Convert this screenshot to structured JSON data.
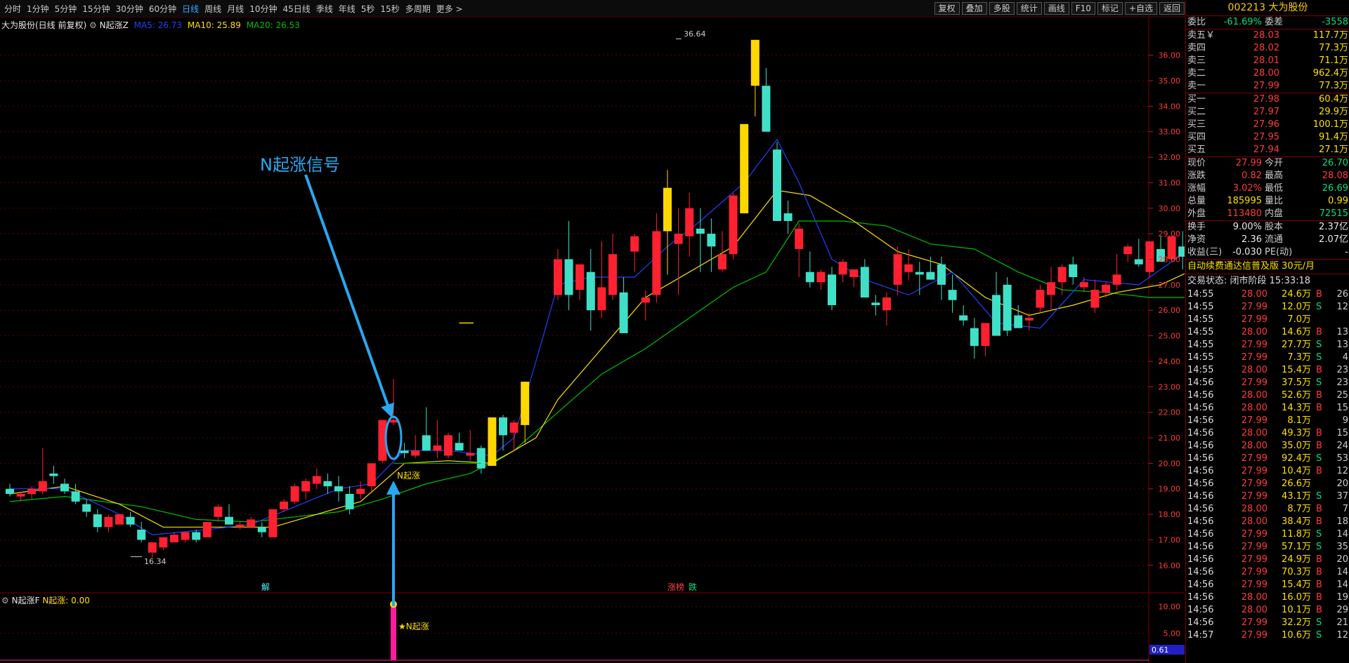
{
  "toolbar": {
    "periods": [
      "分时",
      "1分钟",
      "5分钟",
      "15分钟",
      "30分钟",
      "60分钟",
      "日线",
      "周线",
      "月线",
      "10分钟",
      "45日线",
      "季线",
      "年线",
      "5秒",
      "15秒",
      "多周期",
      "更多 >"
    ],
    "active_period": "日线",
    "tools": [
      "复权",
      "叠加",
      "多股",
      "统计",
      "画线",
      "F10",
      "标记",
      "+自选",
      "返回"
    ]
  },
  "legend": {
    "stock": "大为股份(日线 前复权)",
    "indicator": "N起涨Z",
    "ma5": "MA5: 26.73",
    "ma10": "MA10: 25.89",
    "ma20": "MA20: 26.53"
  },
  "indicator_legend": {
    "name": "N起涨F",
    "value": "N起涨: 0.00"
  },
  "annotations": {
    "signal_title": "N起涨信号",
    "signal_label": "N起涨",
    "low_label": "16.34",
    "high_label": "36.64",
    "star_label": "★N起涨",
    "marker_jie": "解",
    "marker_zhang": "涨榜",
    "marker_die": "跌",
    "ind_box": "0.61"
  },
  "colors": {
    "up": "#ff2030",
    "down": "#40e0c8",
    "limit_up": "#ffd700",
    "ma5": "#2040ff",
    "ma10": "#ffe000",
    "ma20": "#00c000",
    "signal_arrow": "#29a8f0",
    "magenta": "#ff1aa0"
  },
  "chart_data": {
    "type": "candlestick",
    "ylim": [
      15.5,
      37.2
    ],
    "yticks": [
      16,
      17,
      18,
      19,
      20,
      21,
      22,
      23,
      24,
      25,
      26,
      27,
      28,
      29,
      30,
      31,
      32,
      33,
      34,
      35,
      36
    ],
    "candles": [
      [
        19.0,
        19.2,
        18.7,
        18.8
      ],
      [
        18.7,
        18.9,
        18.5,
        18.8
      ],
      [
        18.8,
        19.1,
        18.6,
        19.0
      ],
      [
        18.9,
        20.6,
        18.8,
        19.3
      ],
      [
        19.6,
        19.9,
        19.2,
        19.5
      ],
      [
        19.2,
        19.4,
        18.8,
        18.9
      ],
      [
        18.9,
        19.2,
        18.4,
        18.5
      ],
      [
        18.4,
        18.6,
        17.9,
        18.1
      ],
      [
        18.0,
        18.2,
        17.3,
        17.5
      ],
      [
        17.5,
        18.0,
        17.3,
        17.9
      ],
      [
        17.6,
        18.0,
        17.6,
        18.0
      ],
      [
        17.9,
        18.1,
        17.5,
        17.6
      ],
      [
        17.4,
        17.7,
        16.9,
        17.0
      ],
      [
        16.5,
        16.9,
        16.3,
        16.9
      ],
      [
        16.7,
        17.1,
        16.6,
        17.1
      ],
      [
        16.9,
        17.3,
        16.9,
        17.2
      ],
      [
        17.0,
        17.3,
        16.9,
        17.3
      ],
      [
        17.3,
        17.4,
        16.9,
        17.0
      ],
      [
        17.1,
        17.7,
        17.1,
        17.7
      ],
      [
        17.9,
        18.4,
        17.7,
        18.3
      ],
      [
        17.9,
        18.4,
        17.8,
        17.6
      ],
      [
        17.5,
        17.7,
        17.4,
        17.6
      ],
      [
        17.5,
        17.9,
        17.5,
        17.8
      ],
      [
        17.5,
        17.7,
        17.1,
        17.3
      ],
      [
        17.1,
        18.2,
        17.1,
        18.2
      ],
      [
        18.2,
        18.6,
        18.1,
        18.5
      ],
      [
        18.5,
        19.2,
        18.4,
        19.1
      ],
      [
        18.9,
        19.4,
        18.6,
        19.3
      ],
      [
        19.2,
        19.8,
        19.0,
        19.5
      ],
      [
        19.3,
        19.6,
        18.8,
        19.1
      ],
      [
        19.1,
        19.5,
        18.5,
        18.9
      ],
      [
        18.8,
        19.1,
        18.0,
        18.2
      ],
      [
        18.8,
        19.3,
        18.6,
        19.0
      ],
      [
        19.1,
        20.0,
        18.9,
        20.0
      ],
      [
        20.1,
        21.7,
        20.0,
        21.7
      ],
      [
        21.6,
        23.3,
        21.5,
        21.7
      ],
      [
        20.5,
        20.8,
        20.2,
        20.4
      ],
      [
        20.3,
        21.1,
        20.2,
        20.5
      ],
      [
        21.1,
        22.2,
        20.5,
        20.5
      ],
      [
        20.5,
        21.7,
        20.2,
        20.7
      ],
      [
        20.3,
        21.2,
        20.2,
        21.1
      ],
      [
        20.8,
        21.2,
        20.6,
        20.5
      ],
      [
        20.3,
        21.3,
        20.1,
        20.4
      ],
      [
        20.6,
        20.7,
        19.6,
        19.8
      ],
      [
        19.9,
        21.8,
        19.9,
        21.8
      ],
      [
        21.8,
        21.9,
        20.5,
        21.1
      ],
      [
        21.2,
        21.7,
        20.5,
        21.6
      ],
      [
        21.5,
        22.0,
        20.8,
        23.2
      ],
      [
        null,
        null,
        null,
        null
      ],
      [
        null,
        null,
        null,
        null
      ],
      [
        26.6,
        28.4,
        26.4,
        28.0
      ],
      [
        28.0,
        29.5,
        26.0,
        26.6
      ],
      [
        26.8,
        27.8,
        26.4,
        27.8
      ],
      [
        27.5,
        28.4,
        25.2,
        26.0
      ],
      [
        26.0,
        28.7,
        25.7,
        26.9
      ],
      [
        26.6,
        29.0,
        26.4,
        28.2
      ],
      [
        26.7,
        27.3,
        25.4,
        25.1
      ],
      [
        28.3,
        29.0,
        27.5,
        28.9
      ],
      [
        26.3,
        26.8,
        25.6,
        26.5
      ],
      [
        26.6,
        29.8,
        26.3,
        29.1
      ],
      [
        29.1,
        31.5,
        27.4,
        30.8
      ],
      [
        28.6,
        30.0,
        26.6,
        29.0
      ],
      [
        28.9,
        30.6,
        28.1,
        30.0
      ],
      [
        29.2,
        30.0,
        27.5,
        29.0
      ],
      [
        29.0,
        29.6,
        27.5,
        28.5
      ],
      [
        27.6,
        29.1,
        27.5,
        28.2
      ],
      [
        28.2,
        30.6,
        28.0,
        30.5
      ],
      [
        29.8,
        33.3,
        29.8,
        33.3
      ],
      [
        34.8,
        36.6,
        33.6,
        36.6
      ],
      [
        34.8,
        35.5,
        33.0,
        33.0
      ],
      [
        32.3,
        32.6,
        30.0,
        29.5
      ],
      [
        29.8,
        30.3,
        29.0,
        29.5
      ],
      [
        28.4,
        29.4,
        27.3,
        29.2
      ],
      [
        27.5,
        28.3,
        26.9,
        27.1
      ],
      [
        27.1,
        27.6,
        26.8,
        27.5
      ],
      [
        27.4,
        27.7,
        26.0,
        26.2
      ],
      [
        27.4,
        28.0,
        27.1,
        27.9
      ],
      [
        27.3,
        27.5,
        26.9,
        27.6
      ],
      [
        27.7,
        28.0,
        26.6,
        26.5
      ],
      [
        26.3,
        26.6,
        25.8,
        26.2
      ],
      [
        26.0,
        26.7,
        25.4,
        26.5
      ],
      [
        27.0,
        28.5,
        26.6,
        28.2
      ],
      [
        27.5,
        28.4,
        27.2,
        27.8
      ],
      [
        27.5,
        27.9,
        26.6,
        27.4
      ],
      [
        27.5,
        28.1,
        27.2,
        27.2
      ],
      [
        27.8,
        28.1,
        26.4,
        27.0
      ],
      [
        26.8,
        27.4,
        25.9,
        26.4
      ],
      [
        25.8,
        26.2,
        25.4,
        25.6
      ],
      [
        25.3,
        25.7,
        24.1,
        24.6
      ],
      [
        24.6,
        25.1,
        24.2,
        25.5
      ],
      [
        26.6,
        27.5,
        25.8,
        25.0
      ],
      [
        27.0,
        27.3,
        25.0,
        25.2
      ],
      [
        25.8,
        26.2,
        25.4,
        25.3
      ],
      [
        25.6,
        25.9,
        25.2,
        25.7
      ],
      [
        26.1,
        27.0,
        25.9,
        26.8
      ],
      [
        26.6,
        27.7,
        26.0,
        27.1
      ],
      [
        27.1,
        27.8,
        26.6,
        27.7
      ],
      [
        27.8,
        28.1,
        27.0,
        27.3
      ],
      [
        26.9,
        27.3,
        26.7,
        27.1
      ],
      [
        26.1,
        27.2,
        25.9,
        26.8
      ],
      [
        26.7,
        27.1,
        26.5,
        27.0
      ],
      [
        27.0,
        28.2,
        26.8,
        27.4
      ],
      [
        28.2,
        28.6,
        27.9,
        28.5
      ],
      [
        28.0,
        28.8,
        27.7,
        27.8
      ],
      [
        27.5,
        28.2,
        27.3,
        28.7
      ],
      [
        28.4,
        28.9,
        27.9,
        27.9
      ],
      [
        28.0,
        28.8,
        27.9,
        28.9
      ],
      [
        28.5,
        29.1,
        27.6,
        28.1
      ],
      [
        29.0,
        29.8,
        28.0,
        27.5
      ],
      [
        29.5,
        30.4,
        29.2,
        30.2
      ],
      [
        30.7,
        31.6,
        30.4,
        30.9
      ],
      [
        30.8,
        31.6,
        30.4,
        31.2
      ],
      [
        31.5,
        32.1,
        30.6,
        31.1
      ],
      [
        30.0,
        31.4,
        29.9,
        30.0
      ]
    ],
    "ma5": [
      [
        0,
        19.0
      ],
      [
        5,
        19.0
      ],
      [
        10,
        18.0
      ],
      [
        13,
        17.2
      ],
      [
        18,
        17.4
      ],
      [
        22,
        17.6
      ],
      [
        26,
        18.3
      ],
      [
        30,
        19.0
      ],
      [
        33,
        19.2
      ],
      [
        36,
        20.5
      ],
      [
        40,
        20.5
      ],
      [
        44,
        20.3
      ],
      [
        46,
        21.0
      ],
      [
        50,
        27.0
      ],
      [
        53,
        27.3
      ],
      [
        57,
        27.3
      ],
      [
        60,
        28.5
      ],
      [
        63,
        29.5
      ],
      [
        67,
        31.0
      ],
      [
        70,
        32.7
      ],
      [
        72,
        31.0
      ],
      [
        75,
        28.0
      ],
      [
        78,
        27.2
      ],
      [
        82,
        26.6
      ],
      [
        86,
        27.5
      ],
      [
        90,
        25.5
      ],
      [
        94,
        25.3
      ],
      [
        98,
        27.2
      ],
      [
        103,
        27.0
      ],
      [
        108,
        28.5
      ],
      [
        112,
        29.5
      ],
      [
        115,
        30.4
      ]
    ],
    "ma10": [
      [
        0,
        18.8
      ],
      [
        5,
        19.1
      ],
      [
        10,
        18.4
      ],
      [
        14,
        17.5
      ],
      [
        20,
        17.5
      ],
      [
        24,
        17.5
      ],
      [
        28,
        18.0
      ],
      [
        32,
        18.5
      ],
      [
        36,
        20.0
      ],
      [
        40,
        20.1
      ],
      [
        44,
        20.0
      ],
      [
        48,
        21.0
      ],
      [
        50,
        22.5
      ],
      [
        54,
        24.5
      ],
      [
        58,
        26.5
      ],
      [
        62,
        27.5
      ],
      [
        66,
        28.5
      ],
      [
        70,
        30.7
      ],
      [
        73,
        30.5
      ],
      [
        77,
        29.5
      ],
      [
        81,
        28.3
      ],
      [
        85,
        27.8
      ],
      [
        89,
        26.5
      ],
      [
        93,
        25.8
      ],
      [
        97,
        26.2
      ],
      [
        101,
        26.7
      ],
      [
        105,
        27.0
      ],
      [
        110,
        28.0
      ],
      [
        114,
        29.0
      ],
      [
        115,
        29.8
      ]
    ],
    "ma20": [
      [
        0,
        18.5
      ],
      [
        5,
        18.7
      ],
      [
        12,
        18.3
      ],
      [
        17,
        17.8
      ],
      [
        22,
        17.7
      ],
      [
        26,
        17.9
      ],
      [
        30,
        18.1
      ],
      [
        34,
        18.6
      ],
      [
        38,
        19.2
      ],
      [
        42,
        19.6
      ],
      [
        46,
        20.5
      ],
      [
        50,
        22.0
      ],
      [
        54,
        23.5
      ],
      [
        58,
        24.5
      ],
      [
        62,
        25.7
      ],
      [
        66,
        26.9
      ],
      [
        69,
        27.5
      ],
      [
        72,
        29.5
      ],
      [
        76,
        29.5
      ],
      [
        80,
        29.3
      ],
      [
        84,
        28.6
      ],
      [
        88,
        28.4
      ],
      [
        92,
        27.5
      ],
      [
        96,
        26.8
      ],
      [
        100,
        26.7
      ],
      [
        104,
        26.5
      ],
      [
        108,
        26.5
      ],
      [
        112,
        27.0
      ],
      [
        115,
        28.5
      ]
    ],
    "indicator_ylim": [
      0,
      12
    ],
    "indicator_yticks": [
      5.0,
      10.0
    ],
    "indicator_signal_index": 35,
    "indicator_signal_value": 10
  },
  "quote": {
    "code_name": "002213 大为股份",
    "weibi_label": "委比",
    "weibi": "-61.69%",
    "weicha_label": "委差",
    "weicha": "-3558",
    "asks": [
      {
        "label": "卖五￥",
        "price": "28.03",
        "vol": "117.7万"
      },
      {
        "label": "卖四",
        "price": "28.02",
        "vol": "77.3万"
      },
      {
        "label": "卖三",
        "price": "28.01",
        "vol": "71.1万"
      },
      {
        "label": "卖二",
        "price": "28.00",
        "vol": "962.4万"
      },
      {
        "label": "卖一",
        "price": "27.99",
        "vol": "77.3万"
      }
    ],
    "bids": [
      {
        "label": "买一",
        "price": "27.98",
        "vol": "60.4万"
      },
      {
        "label": "买二",
        "price": "27.97",
        "vol": "29.9万"
      },
      {
        "label": "买三",
        "price": "27.96",
        "vol": "100.1万"
      },
      {
        "label": "买四",
        "price": "27.95",
        "vol": "91.4万"
      },
      {
        "label": "买五",
        "price": "27.94",
        "vol": "27.1万"
      }
    ],
    "stats1": [
      {
        "l1": "现价",
        "v1": "27.99",
        "c1": "red",
        "l2": "今开",
        "v2": "26.70",
        "c2": "green"
      },
      {
        "l1": "涨跌",
        "v1": "0.82",
        "c1": "red",
        "l2": "最高",
        "v2": "28.08",
        "c2": "red"
      },
      {
        "l1": "涨幅",
        "v1": "3.02%",
        "c1": "red",
        "l2": "最低",
        "v2": "26.69",
        "c2": "green"
      },
      {
        "l1": "总量",
        "v1": "185995",
        "c1": "yellow",
        "l2": "量比",
        "v2": "0.99",
        "c2": "yellow"
      },
      {
        "l1": "外盘",
        "v1": "113480",
        "c1": "red",
        "l2": "内盘",
        "v2": "72515",
        "c2": "green"
      }
    ],
    "stats2": [
      {
        "l1": "换手",
        "v1": "9.00%",
        "c1": "white",
        "l2": "股本",
        "v2": "2.37亿",
        "c2": "white"
      },
      {
        "l1": "净资",
        "v1": "2.36",
        "c1": "white",
        "l2": "流通",
        "v2": "2.07亿",
        "c2": "white"
      },
      {
        "l1": "收益(三)",
        "v1": "-0.030",
        "c1": "white",
        "l2": "PE(动)",
        "v2": "-",
        "c2": "white"
      }
    ],
    "ad": "自动续费通达信普及版 30元/月",
    "state": "交易状态: 闭市阶段 15:33:18",
    "ticks": [
      [
        "14:55",
        "28.00",
        "24.6万",
        "B",
        "26"
      ],
      [
        "14:55",
        "27.99",
        "12.0万",
        "S",
        "12"
      ],
      [
        "14:55",
        "27.99",
        "7.0万",
        "",
        ""
      ],
      [
        "14:55",
        "28.00",
        "14.6万",
        "B",
        "13"
      ],
      [
        "14:55",
        "27.99",
        "27.7万",
        "S",
        "13"
      ],
      [
        "14:55",
        "27.99",
        "7.3万",
        "S",
        "4"
      ],
      [
        "14:55",
        "28.00",
        "15.4万",
        "B",
        "23"
      ],
      [
        "14:56",
        "27.99",
        "37.5万",
        "S",
        "23"
      ],
      [
        "14:56",
        "28.00",
        "52.6万",
        "B",
        "25"
      ],
      [
        "14:56",
        "28.00",
        "14.3万",
        "B",
        "15"
      ],
      [
        "14:56",
        "27.99",
        "8.1万",
        "",
        "9"
      ],
      [
        "14:56",
        "28.00",
        "49.3万",
        "B",
        "15"
      ],
      [
        "14:56",
        "28.00",
        "35.0万",
        "B",
        "24"
      ],
      [
        "14:56",
        "27.99",
        "92.4万",
        "S",
        "53"
      ],
      [
        "14:56",
        "27.99",
        "10.4万",
        "B",
        "12"
      ],
      [
        "14:56",
        "27.99",
        "26.6万",
        "",
        "20"
      ],
      [
        "14:56",
        "27.99",
        "43.1万",
        "S",
        "37"
      ],
      [
        "14:56",
        "28.00",
        "8.7万",
        "B",
        "7"
      ],
      [
        "14:56",
        "28.00",
        "38.4万",
        "B",
        "18"
      ],
      [
        "14:56",
        "27.99",
        "11.8万",
        "S",
        "14"
      ],
      [
        "14:56",
        "27.99",
        "57.1万",
        "S",
        "35"
      ],
      [
        "14:56",
        "27.99",
        "24.9万",
        "B",
        "20"
      ],
      [
        "14:56",
        "27.99",
        "70.3万",
        "B",
        "14"
      ],
      [
        "14:56",
        "27.99",
        "15.4万",
        "B",
        "14"
      ],
      [
        "14:56",
        "28.00",
        "16.0万",
        "B",
        "19"
      ],
      [
        "14:56",
        "28.00",
        "10.1万",
        "B",
        "29"
      ],
      [
        "14:56",
        "27.99",
        "32.2万",
        "S",
        "21"
      ],
      [
        "14:57",
        "27.99",
        "10.6万",
        "S",
        "12"
      ]
    ]
  }
}
